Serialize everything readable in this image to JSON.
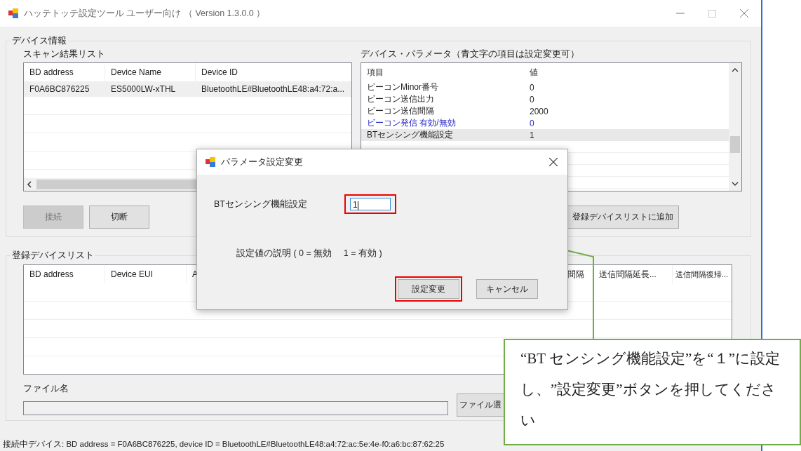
{
  "window": {
    "title": "ハッテトッテ設定ツール ユーザー向け （ Version 1.3.0.0 ）"
  },
  "device_info": {
    "label": "デバイス情報",
    "scan_list": {
      "label": "スキャン結果リスト",
      "columns": [
        "BD address",
        "Device Name",
        "Device ID"
      ],
      "rows": [
        {
          "cells": [
            "F0A6BC876225",
            "ES5000LW-xTHL",
            "BluetoothLE#BluetoothLE48:a4:72:a..."
          ],
          "selected": true
        }
      ]
    },
    "parameters": {
      "label": "デバイス・パラメータ（青文字の項目は設定変更可）",
      "columns": [
        "項目",
        "値"
      ],
      "rows": [
        {
          "cells": [
            "ビーコンMinor番号",
            "0"
          ],
          "editable": false,
          "selected": false
        },
        {
          "cells": [
            "ビーコン送信出力",
            "0"
          ],
          "editable": false,
          "selected": false
        },
        {
          "cells": [
            "ビーコン送信間隔",
            "2000"
          ],
          "editable": false,
          "selected": false
        },
        {
          "cells": [
            "ビーコン発信 有効/無効",
            "0"
          ],
          "editable": true,
          "selected": false
        },
        {
          "cells": [
            "BTセンシング機能設定",
            "1"
          ],
          "editable": false,
          "selected": true
        }
      ]
    },
    "buttons": [
      {
        "label": "接続",
        "disabled": true
      },
      {
        "label": "切断",
        "disabled": false
      }
    ],
    "add_button": "登録デバイスリストに追加"
  },
  "registered": {
    "label": "登録デバイスリスト",
    "columns": [
      "BD address",
      "Device EUI",
      "A",
      "",
      "",
      "",
      "間隔",
      "送信間隔延長...",
      "送信間隔復帰..."
    ],
    "file_label": "ファイル名",
    "file_button": "ファイル選"
  },
  "status_bar": "接続中デバイス:  BD address = F0A6BC876225,  device ID = BluetoothLE#BluetoothLE48:a4:72:ac:5e:4e-f0:a6:bc:87:62:25",
  "dialog": {
    "title": "パラメータ設定変更",
    "field_label": "BTセンシング機能設定",
    "value": "1",
    "description": "設定値の説明 ( 0 = 無効　 1 = 有効 )",
    "buttons": [
      "設定変更",
      "キャンセル"
    ]
  },
  "callout": "“BT センシング機能設定”を“１”に設定し、”設定変更”ボタンを押してください"
}
